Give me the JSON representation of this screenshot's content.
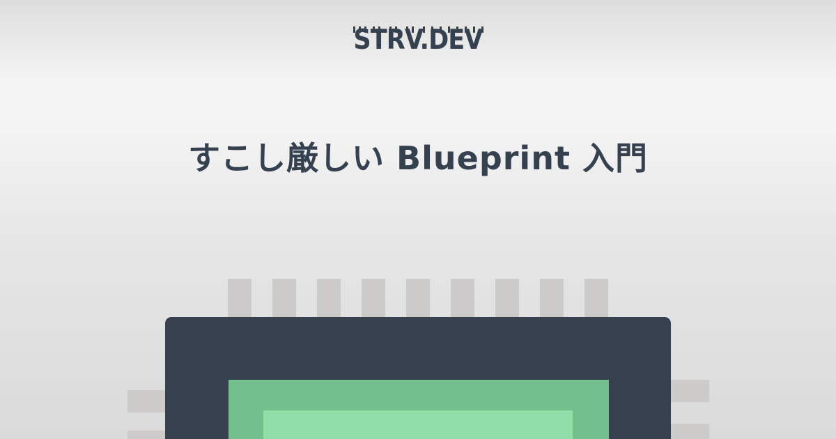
{
  "logo": {
    "text": "STRV.DEV",
    "color": "#364150"
  },
  "title": "すこし厳しい Blueprint 入門",
  "colors": {
    "text": "#364150",
    "chip_body": "#36404e",
    "chip_die_outer": "#73bf8e",
    "chip_die_inner": "#91dfa8",
    "chip_pins": "#cdcbca",
    "background": "#f3f3f3"
  },
  "illustration": {
    "icon": "microchip-icon",
    "top_pin_count": 9
  }
}
